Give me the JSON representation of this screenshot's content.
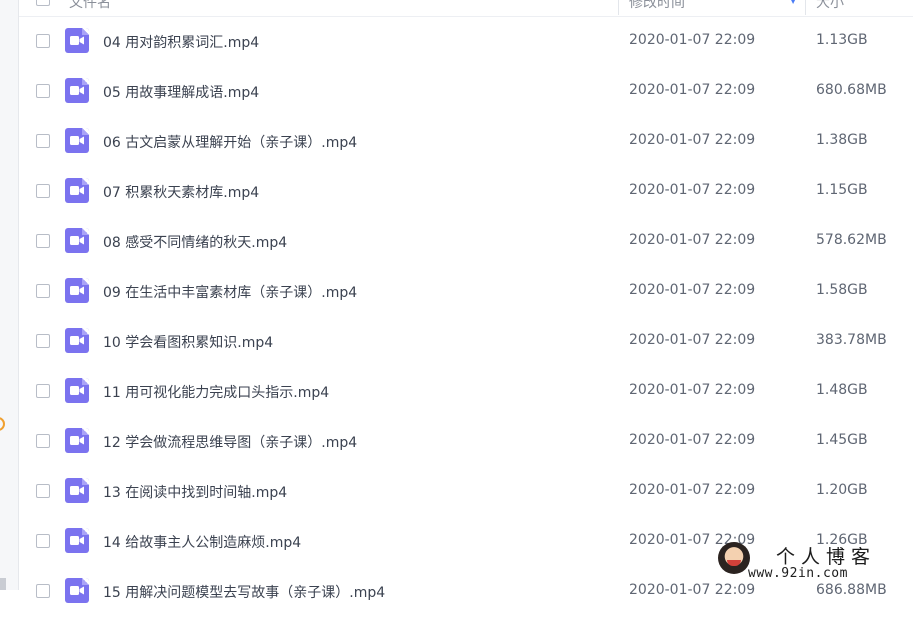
{
  "header": {
    "name_col": "文件名",
    "time_col": "修改时间",
    "size_col": "大小"
  },
  "files": [
    {
      "name": "04 用对韵积累词汇.mp4",
      "time": "2020-01-07 22:09",
      "size": "1.13GB",
      "icon": "video-file-icon"
    },
    {
      "name": "05 用故事理解成语.mp4",
      "time": "2020-01-07 22:09",
      "size": "680.68MB",
      "icon": "video-file-icon"
    },
    {
      "name": "06 古文启蒙从理解开始（亲子课）.mp4",
      "time": "2020-01-07 22:09",
      "size": "1.38GB",
      "icon": "video-file-icon"
    },
    {
      "name": "07 积累秋天素材库.mp4",
      "time": "2020-01-07 22:09",
      "size": "1.15GB",
      "icon": "video-file-icon"
    },
    {
      "name": "08 感受不同情绪的秋天.mp4",
      "time": "2020-01-07 22:09",
      "size": "578.62MB",
      "icon": "video-file-icon"
    },
    {
      "name": "09 在生活中丰富素材库（亲子课）.mp4",
      "time": "2020-01-07 22:09",
      "size": "1.58GB",
      "icon": "video-file-icon"
    },
    {
      "name": "10 学会看图积累知识.mp4",
      "time": "2020-01-07 22:09",
      "size": "383.78MB",
      "icon": "video-file-icon"
    },
    {
      "name": "11 用可视化能力完成口头指示.mp4",
      "time": "2020-01-07 22:09",
      "size": "1.48GB",
      "icon": "video-file-icon"
    },
    {
      "name": "12 学会做流程思维导图（亲子课）.mp4",
      "time": "2020-01-07 22:09",
      "size": "1.45GB",
      "icon": "video-file-icon"
    },
    {
      "name": "13 在阅读中找到时间轴.mp4",
      "time": "2020-01-07 22:09",
      "size": "1.20GB",
      "icon": "video-file-icon"
    },
    {
      "name": "14 给故事主人公制造麻烦.mp4",
      "time": "2020-01-07 22:09",
      "size": "1.26GB",
      "icon": "video-file-icon"
    },
    {
      "name": "15 用解决问题模型去写故事（亲子课）.mp4",
      "time": "2020-01-07 22:09",
      "size": "686.88MB",
      "icon": "video-file-icon"
    }
  ],
  "watermark": {
    "title": "个人博客",
    "url": "www.92in.com"
  },
  "colors": {
    "video_icon": "#7b73ef",
    "accent": "#4a7cf6",
    "text": "#3b4250",
    "muted_text": "#5f6673"
  }
}
